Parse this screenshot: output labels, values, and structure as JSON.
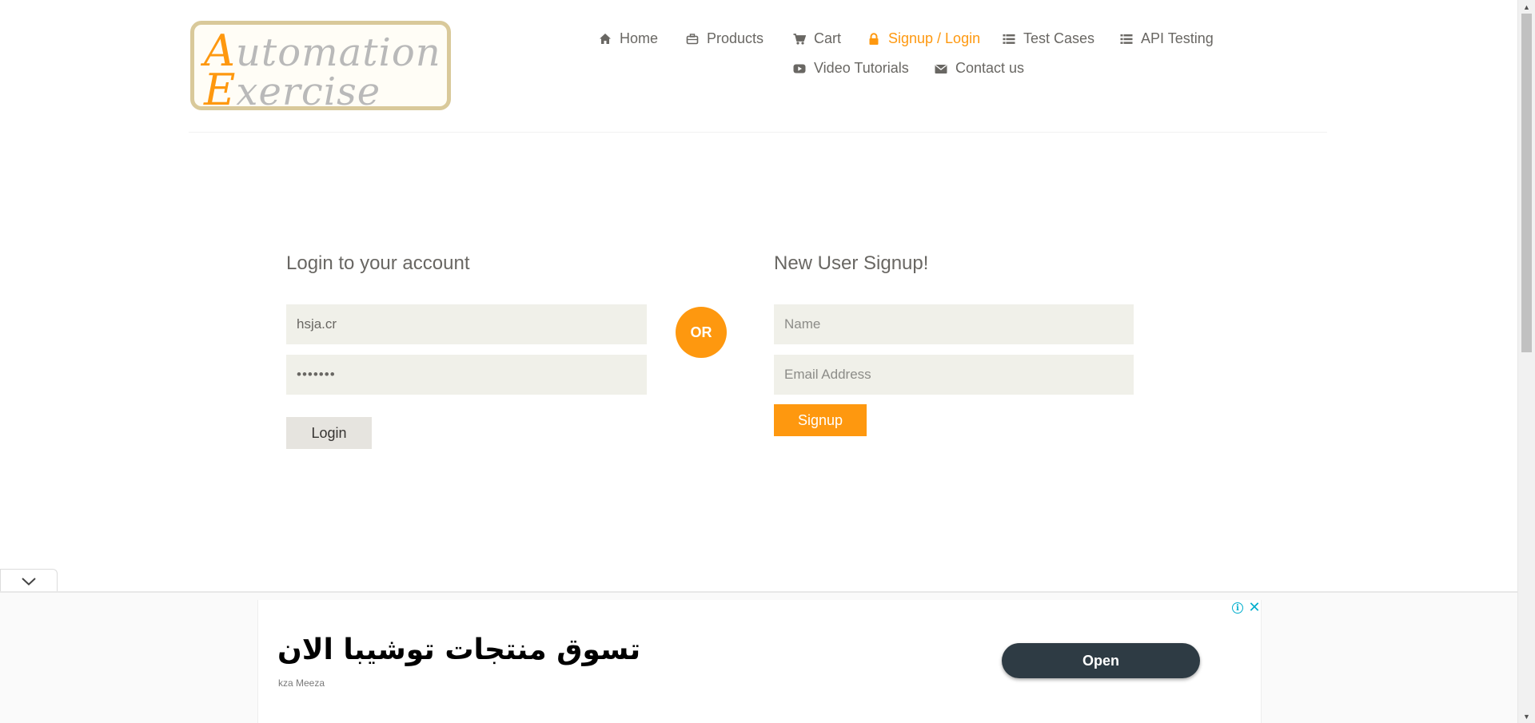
{
  "logo": {
    "line1_cap": "A",
    "line1_rest": "utomation",
    "line2_cap": "E",
    "line2_rest": "xercise"
  },
  "nav": {
    "items": [
      {
        "label": "Home",
        "icon": "home-icon"
      },
      {
        "label": "Products",
        "icon": "briefcase-icon"
      },
      {
        "label": "Cart",
        "icon": "cart-icon"
      },
      {
        "label": "Signup / Login",
        "icon": "lock-icon",
        "active": true
      },
      {
        "label": "Test Cases",
        "icon": "list-icon"
      },
      {
        "label": "API Testing",
        "icon": "list-icon"
      },
      {
        "label": "Video Tutorials",
        "icon": "youtube-play-icon"
      },
      {
        "label": "Contact us",
        "icon": "envelope-icon"
      }
    ]
  },
  "login": {
    "title": "Login to your account",
    "email_value": "hsja.cr",
    "password_value": "•••••••",
    "button_label": "Login"
  },
  "or_label": "OR",
  "signup": {
    "title": "New User Signup!",
    "name_placeholder": "Name",
    "email_placeholder": "Email Address",
    "button_label": "Signup"
  },
  "ad": {
    "headline": "تسوق منتجات توشيبا الان",
    "advertiser": "kza Meeza",
    "open_label": "Open",
    "info_label": "i",
    "close_label": "✕"
  },
  "colors": {
    "accent": "#fe980f",
    "field_bg": "#f0f0e9",
    "text": "#696763",
    "ad_button": "#2e3b44",
    "ad_icon": "#00aecd"
  }
}
